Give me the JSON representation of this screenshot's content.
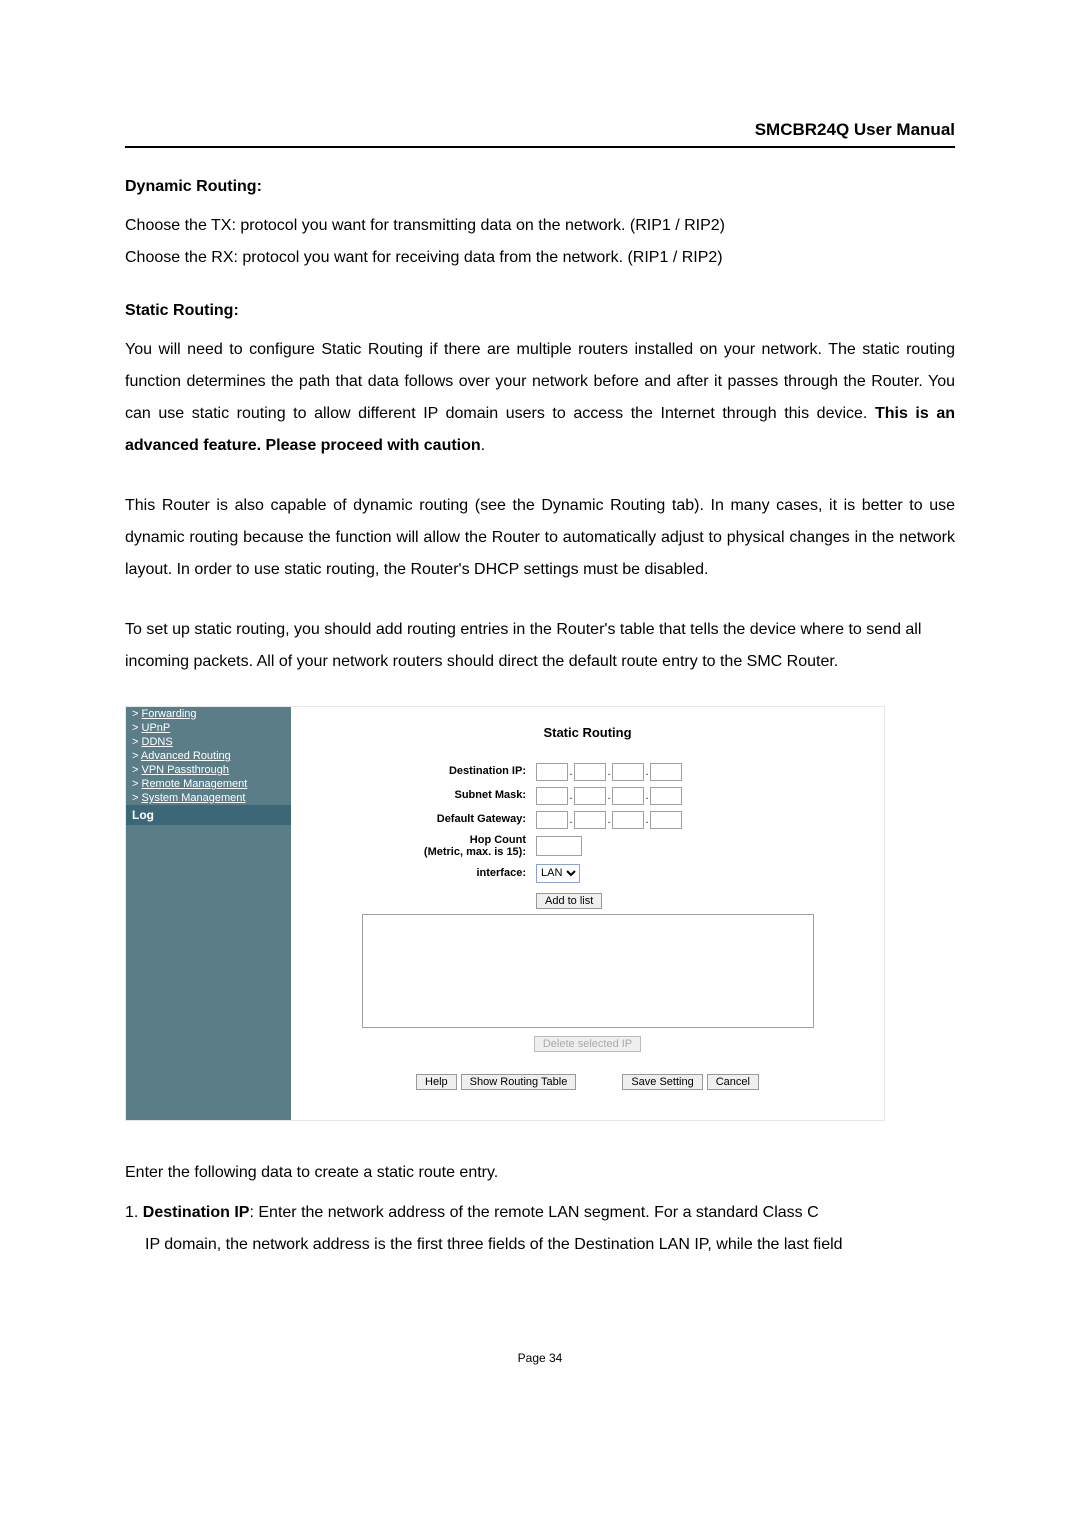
{
  "header": {
    "title": "SMCBR24Q User Manual"
  },
  "sections": {
    "dynamic_routing_heading": "Dynamic Routing:",
    "dynamic_routing_p1": "Choose the TX: protocol you want for transmitting data on the network. (RIP1 / RIP2)",
    "dynamic_routing_p2": "Choose the RX: protocol you want for receiving data from the network. (RIP1 / RIP2)",
    "static_routing_heading": "Static Routing:",
    "static_routing_p1a": "You will need to configure Static Routing if there are multiple routers installed on your network. The static routing function determines the path that data follows over your network before and after it passes through the Router. You can use static routing to allow different IP domain users to access the Internet through this device. ",
    "static_routing_p1b_bold": "This is an advanced feature. Please proceed with caution",
    "static_routing_p1c": ".",
    "static_routing_p2": "This Router is also capable of dynamic routing (see the Dynamic Routing tab). In many cases, it is better to use dynamic routing because the function will allow the Router to automatically adjust to physical changes in the network layout. In order to use static routing, the Router's DHCP settings must be disabled.",
    "static_routing_p3": "To set up static routing, you should add routing entries in the Router's table that tells the device where to send all incoming packets. All of your network routers should direct the default route entry to the SMC Router."
  },
  "router_ui": {
    "sidebar": {
      "items": [
        {
          "label": "Forwarding",
          "prefix": ">"
        },
        {
          "label": "UPnP",
          "prefix": ">"
        },
        {
          "label": "DDNS",
          "prefix": ">"
        },
        {
          "label": "Advanced Routing",
          "prefix": ">"
        },
        {
          "label": "VPN Passthrough",
          "prefix": ">"
        },
        {
          "label": "Remote Management",
          "prefix": ">"
        },
        {
          "label": "System Management",
          "prefix": ">"
        }
      ],
      "log_label": "Log"
    },
    "main": {
      "title": "Static Routing",
      "labels": {
        "destination_ip": "Destination IP:",
        "subnet_mask": "Subnet Mask:",
        "default_gateway": "Default Gateway:",
        "hop_count": "Hop Count\n(Metric, max. is 15):",
        "interface": "interface:"
      },
      "interface_value": "LAN",
      "buttons": {
        "add_to_list": "Add to list",
        "delete_selected": "Delete selected IP",
        "help": "Help",
        "show_routing_table": "Show Routing Table",
        "save_setting": "Save Setting",
        "cancel": "Cancel"
      }
    }
  },
  "footer": {
    "intro": "Enter the following data to create a static route entry.",
    "item1_num": "1. ",
    "item1_bold": "Destination IP",
    "item1_rest": ": Enter the network address of the remote LAN segment. For a standard Class C",
    "item1_cont": "IP domain, the network address is the first three fields of the Destination LAN IP, while the last field"
  },
  "page_number": "Page 34"
}
